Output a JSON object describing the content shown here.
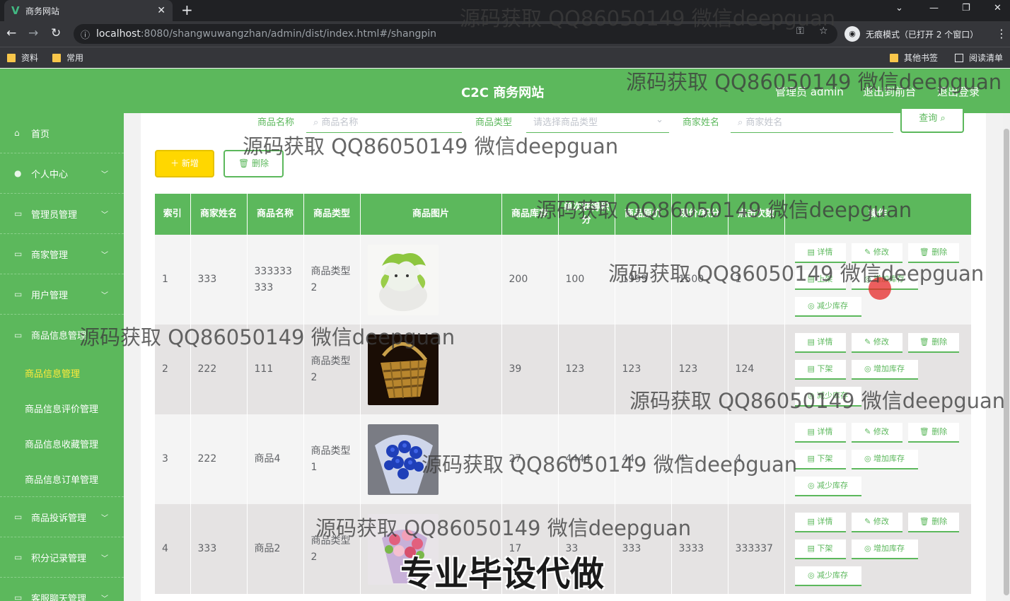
{
  "browser": {
    "tab_title": "商务网站",
    "tab_favicon": "V",
    "url_host": "localhost",
    "url_path": ":8080/shangwuwangzhan/admin/dist/index.html#/shangpin",
    "incognito_label": "无痕模式（已打开 2 个窗口）",
    "bookmarks": [
      "资料",
      "常用"
    ],
    "bookmarks_right": [
      "其他书签",
      "阅读清单"
    ]
  },
  "header": {
    "title": "C2C 商务网站",
    "admin_label": "管理员 admin",
    "to_front": "退出到前台",
    "logout": "退出登录"
  },
  "sidebar": {
    "items": [
      {
        "label": "首页",
        "icon": "home-icon",
        "chevron": false
      },
      {
        "label": "个人中心",
        "icon": "user-icon",
        "chevron": true
      },
      {
        "label": "管理员管理",
        "icon": "menu-icon",
        "chevron": true
      },
      {
        "label": "商家管理",
        "icon": "menu-icon",
        "chevron": true
      },
      {
        "label": "用户管理",
        "icon": "menu-icon",
        "chevron": true
      },
      {
        "label": "商品信息管理",
        "icon": "menu-icon",
        "chevron": false
      }
    ],
    "sub_items": [
      {
        "label": "商品信息管理",
        "active": true
      },
      {
        "label": "商品信息评价管理",
        "active": false
      },
      {
        "label": "商品信息收藏管理",
        "active": false
      },
      {
        "label": "商品信息订单管理",
        "active": false
      }
    ],
    "after_items": [
      {
        "label": "商品投诉管理",
        "icon": "menu-icon",
        "chevron": true
      },
      {
        "label": "积分记录管理",
        "icon": "menu-icon",
        "chevron": true
      },
      {
        "label": "客服聊天管理",
        "icon": "menu-icon",
        "chevron": true
      }
    ]
  },
  "search": {
    "name_label": "商品名称",
    "name_placeholder": "商品名称",
    "type_label": "商品类型",
    "type_placeholder": "请选择商品类型",
    "seller_label": "商家姓名",
    "seller_placeholder": "商家姓名",
    "query_button": "查询"
  },
  "actions": {
    "add": "新增",
    "delete": "删除"
  },
  "table": {
    "columns": [
      "索引",
      "商家姓名",
      "商品名称",
      "商品类型",
      "商品图片",
      "商品库存",
      "单次获得积分",
      "商品原价",
      "现价/积分",
      "点击次数",
      "操作"
    ],
    "rows": [
      {
        "index": "1",
        "seller": "333",
        "name": "333333333",
        "type": "商品类型2",
        "image": "cat-statue",
        "stock": "200",
        "points": "100",
        "orig": "1999",
        "price": "1500",
        "clicks": "1",
        "status_btn": "上架"
      },
      {
        "index": "2",
        "seller": "222",
        "name": "111",
        "type": "商品类型2",
        "image": "bamboo-basket",
        "stock": "39",
        "points": "123",
        "orig": "123",
        "price": "123",
        "clicks": "124",
        "status_btn": "下架"
      },
      {
        "index": "3",
        "seller": "222",
        "name": "商品4",
        "type": "商品类型1",
        "image": "blue-rose-bouquet",
        "stock": "27",
        "points": "4444",
        "orig": "44",
        "price": "4",
        "clicks": "4",
        "status_btn": "下架"
      },
      {
        "index": "4",
        "seller": "333",
        "name": "商品2",
        "type": "商品类型2",
        "image": "flower-bouquet",
        "stock": "17",
        "points": "33",
        "orig": "333",
        "price": "3333",
        "clicks": "333337",
        "status_btn": "下架"
      }
    ],
    "op_labels": {
      "detail": "详情",
      "edit": "修改",
      "delete": "删除",
      "increase": "增加库存",
      "decrease": "减少库存"
    }
  },
  "watermarks": {
    "text": "源码获取 QQ86050149 微信deepguan",
    "banner": "专业毕设代做"
  },
  "colors": {
    "primary": "#5cb85c",
    "add_button": "#ffd700",
    "active_submenu": "#ffeb3b"
  }
}
